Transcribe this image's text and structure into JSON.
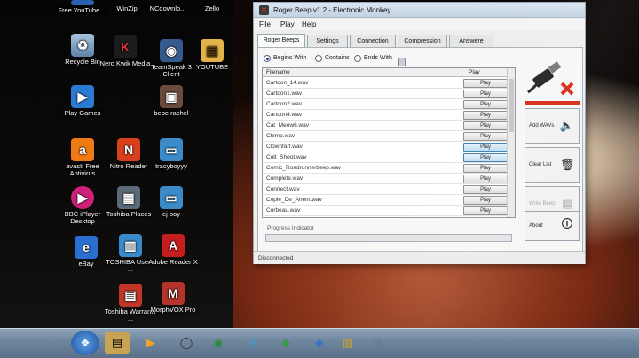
{
  "desktop": {
    "icons": [
      {
        "label": "Free YouTube ...",
        "icon": "youtube-downloader-icon",
        "color": "#2b5fb0"
      },
      {
        "label": "WinZip",
        "icon": "winzip-icon",
        "color": "#b58a1a"
      },
      {
        "label": "NCdownlo...",
        "icon": "ncdownloader-icon",
        "color": "#3d3d3d"
      },
      {
        "label": "Zello",
        "icon": "zello-icon",
        "color": "#e77a1e"
      },
      {
        "label": "Recycle Bin",
        "icon": "recycle-bin-icon",
        "color": "#6f8fb3"
      },
      {
        "label": "Nero Kwik Media",
        "icon": "nero-icon",
        "color": "#1c1c1c"
      },
      {
        "label": "TeamSpeak 3 Client",
        "icon": "teamspeak-icon",
        "color": "#355a8c"
      },
      {
        "label": "YOUTUBE",
        "icon": "folder-icon",
        "color": "#e3b34a"
      },
      {
        "label": "Play Games",
        "icon": "play-games-icon",
        "color": "#2a7bd4"
      },
      {
        "label": "bebe rachel",
        "icon": "photo-icon",
        "color": "#6a4a3a"
      },
      {
        "label": "avast! Free Antivirus",
        "icon": "avast-icon",
        "color": "#f07a14"
      },
      {
        "label": "Nitro Reader",
        "icon": "nitro-reader-icon",
        "color": "#d8401c"
      },
      {
        "label": "tracyboyyy",
        "icon": "computer-icon",
        "color": "#3b8bc8"
      },
      {
        "label": "BBC iPlayer Desktop",
        "icon": "bbc-iplayer-icon",
        "color": "#d0217a"
      },
      {
        "label": "Toshiba Places",
        "icon": "toshiba-places-icon",
        "color": "#5a6a7a"
      },
      {
        "label": "ej boy",
        "icon": "folder-icon",
        "color": "#3b8bc8"
      },
      {
        "label": "eBay",
        "icon": "ebay-icon",
        "color": "#2a6fcf"
      },
      {
        "label": "TOSHIBA User's ...",
        "icon": "toshiba-manual-icon",
        "color": "#3a89c9"
      },
      {
        "label": "Adobe Reader X",
        "icon": "adobe-reader-icon",
        "color": "#c41e1e"
      },
      {
        "label": "Toshiba Warranty ...",
        "icon": "toshiba-warranty-icon",
        "color": "#c2362a"
      },
      {
        "label": "MorphVOX Pro",
        "icon": "morphvox-icon",
        "color": "#b3342a"
      }
    ]
  },
  "window": {
    "title": "Roger Beep v1.2 - Electronic Monkey",
    "menu": [
      "File",
      "Play",
      "Help"
    ],
    "tabs": [
      "Roger Beeps",
      "Settings",
      "Connection",
      "Compression",
      "Answere"
    ],
    "filter": {
      "options": [
        "Begins With",
        "Contains",
        "Ends With"
      ],
      "selected": "Begins With"
    },
    "list": {
      "columns": [
        "Filename",
        "Play"
      ],
      "rows": [
        {
          "file": "Cartoon_14.wav",
          "play": "Play"
        },
        {
          "file": "Cartoon1.wav",
          "play": "Play"
        },
        {
          "file": "Cartoon2.wav",
          "play": "Play"
        },
        {
          "file": "Cartoon4.wav",
          "play": "Play"
        },
        {
          "file": "Cat_Meow6.wav",
          "play": "Play"
        },
        {
          "file": "Chimp.wav",
          "play": "Play"
        },
        {
          "file": "Clownfart.wav",
          "play": "Play"
        },
        {
          "file": "Colt_Shoot.wav",
          "play": "Play"
        },
        {
          "file": "Comic_Roadrunnerbeep.wav",
          "play": "Play"
        },
        {
          "file": "Complete.wav",
          "play": "Play"
        },
        {
          "file": "Connect.wav",
          "play": "Play"
        },
        {
          "file": "Copie_De_Ahem.wav",
          "play": "Play"
        },
        {
          "file": "Corbeau.wav",
          "play": "Play"
        }
      ]
    },
    "progress_label": "Progress Indicator",
    "status": "Disconnected",
    "side_buttons": {
      "add_wavs": "Add WAVs",
      "clear_list": "Clear List",
      "write_beep": "Write Beep",
      "about": "About"
    }
  }
}
